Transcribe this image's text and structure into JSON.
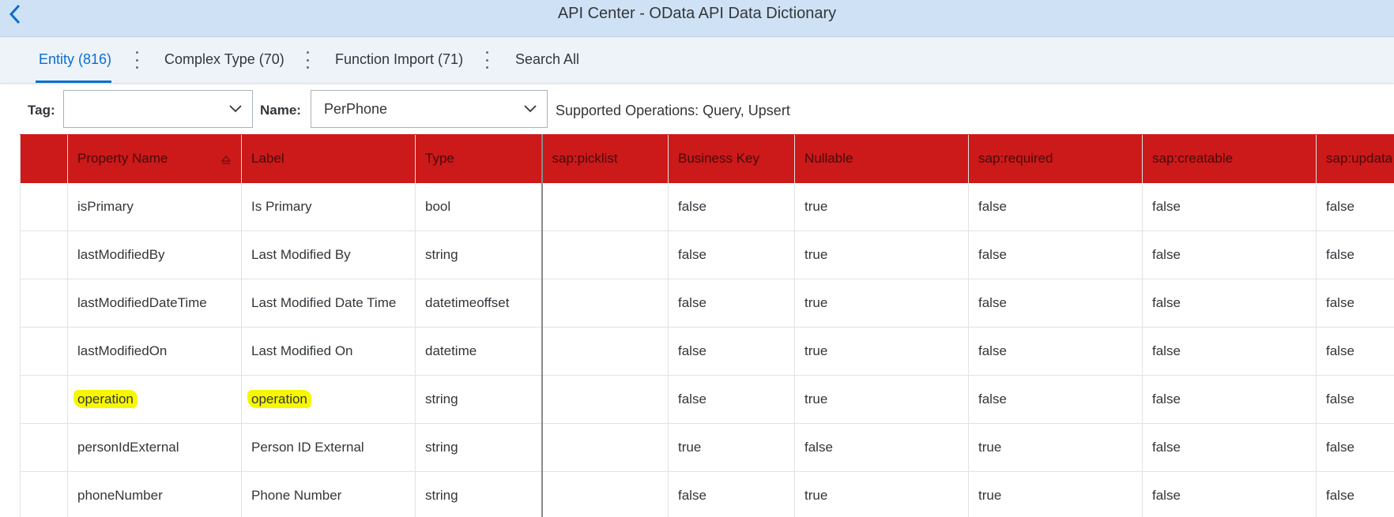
{
  "header": {
    "title": "API Center - OData API Data Dictionary",
    "back_icon": "chevron-left-icon"
  },
  "tabs": [
    {
      "label": "Entity (816)",
      "active": true
    },
    {
      "label": "Complex Type (70)",
      "active": false
    },
    {
      "label": "Function Import (71)",
      "active": false
    },
    {
      "label": "Search All",
      "active": false
    }
  ],
  "filters": {
    "tag_label": "Tag:",
    "tag_value": "",
    "name_label": "Name:",
    "name_value": "PerPhone",
    "supported_operations": "Supported Operations: Query, Upsert"
  },
  "table": {
    "header_color": "#cc1919",
    "columns": [
      "",
      "Property Name",
      "Label",
      "Type",
      "sap:picklist",
      "Business Key",
      "Nullable",
      "sap:required",
      "sap:creatable",
      "sap:updata"
    ],
    "sorted_column": "Property Name",
    "rows": [
      {
        "property": "isPrimary",
        "label": "Is Primary",
        "type": "bool",
        "picklist": "",
        "business_key": "false",
        "nullable": "true",
        "required": "false",
        "creatable": "false",
        "updatable": "false",
        "highlighted": false
      },
      {
        "property": "lastModifiedBy",
        "label": "Last Modified By",
        "type": "string",
        "picklist": "",
        "business_key": "false",
        "nullable": "true",
        "required": "false",
        "creatable": "false",
        "updatable": "false",
        "highlighted": false
      },
      {
        "property": "lastModifiedDateTime",
        "label": "Last Modified Date Time",
        "type": "datetimeoffset",
        "picklist": "",
        "business_key": "false",
        "nullable": "true",
        "required": "false",
        "creatable": "false",
        "updatable": "false",
        "highlighted": false
      },
      {
        "property": "lastModifiedOn",
        "label": "Last Modified On",
        "type": "datetime",
        "picklist": "",
        "business_key": "false",
        "nullable": "true",
        "required": "false",
        "creatable": "false",
        "updatable": "false",
        "highlighted": false
      },
      {
        "property": "operation",
        "label": "operation",
        "type": "string",
        "picklist": "",
        "business_key": "false",
        "nullable": "true",
        "required": "false",
        "creatable": "false",
        "updatable": "false",
        "highlighted": true
      },
      {
        "property": "personIdExternal",
        "label": "Person ID External",
        "type": "string",
        "picklist": "",
        "business_key": "true",
        "nullable": "false",
        "required": "true",
        "creatable": "false",
        "updatable": "false",
        "highlighted": false
      },
      {
        "property": "phoneNumber",
        "label": "Phone Number",
        "type": "string",
        "picklist": "",
        "business_key": "false",
        "nullable": "true",
        "required": "true",
        "creatable": "false",
        "updatable": "false",
        "highlighted": false
      }
    ]
  }
}
